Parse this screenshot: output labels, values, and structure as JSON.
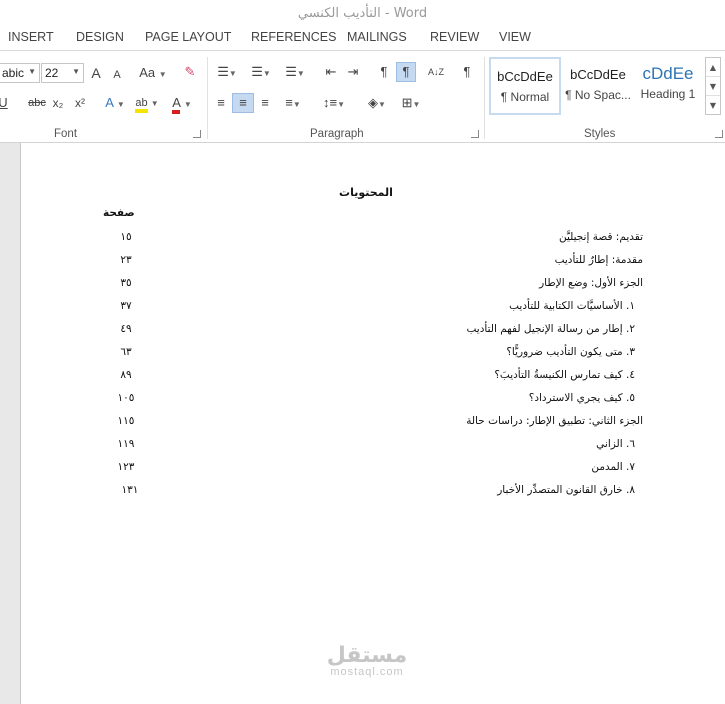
{
  "window": {
    "title": "التأديب الكنسي - Word"
  },
  "tabs": [
    "INSERT",
    "DESIGN",
    "PAGE LAYOUT",
    "REFERENCES",
    "MAILINGS",
    "REVIEW",
    "VIEW"
  ],
  "ribbon": {
    "font": {
      "name": "abic",
      "size": "22",
      "group_label": "Font",
      "grow": "A",
      "shrink": "A",
      "change_case": "Aa",
      "underline": "U",
      "strike": "abc",
      "subscript": "x₂",
      "superscript": "x²",
      "text_effects": "A",
      "highlight": "ab",
      "font_color": "A",
      "highlight_color": "#f5e400",
      "font_color_value": "#d22020"
    },
    "paragraph": {
      "group_label": "Paragraph",
      "ltr": "¶",
      "rtl": "¶",
      "sort": "A↓Z",
      "show_marks": "¶"
    },
    "styles": {
      "group_label": "Styles",
      "items": [
        {
          "sample": "bCcDdEe",
          "name": "¶ Normal"
        },
        {
          "sample": "bCcDdEe",
          "name": "¶ No Spac..."
        },
        {
          "sample": "cDdEe",
          "name": "Heading 1"
        }
      ]
    }
  },
  "document": {
    "heading": "المحتويات",
    "page_column_header": "صفحة",
    "entries": [
      {
        "title": "تقديم: قصة إنجيليَّن",
        "page": "١٥"
      },
      {
        "title": "مقدمة: إطارٌ للتأديب",
        "page": "٢٣"
      },
      {
        "title": "الجزء الأول: وضع الإطار",
        "page": "٣٥"
      },
      {
        "title": "١. الأساسيَّات الكتابية للتأديب",
        "page": "٣٧"
      },
      {
        "title": "٢. إطار من رسالة الإنجيل لفهم التأديب",
        "page": "٤٩"
      },
      {
        "title": "٣. متى يكون التأديب ضروريًّا؟",
        "page": "٦٣"
      },
      {
        "title": "٤. كيف تمارس الكنيسةُ التأديبَ؟",
        "page": "٨٩"
      },
      {
        "title": "٥. كيف يجري الاسترداد؟",
        "page": "١٠٥"
      },
      {
        "title": "الجزء الثاني: تطبيق الإطار: دراسات حالة",
        "page": "١١٥"
      },
      {
        "title": "٦. الزاني",
        "page": "١١٩"
      },
      {
        "title": "٧. المدمن",
        "page": "١٢٣"
      },
      {
        "title": "٨. خارق القانون المتصدِّر الأخبار",
        "page": "١٣١"
      }
    ]
  },
  "watermark": {
    "arabic": "مستقل",
    "latin": "mostaql.com"
  }
}
